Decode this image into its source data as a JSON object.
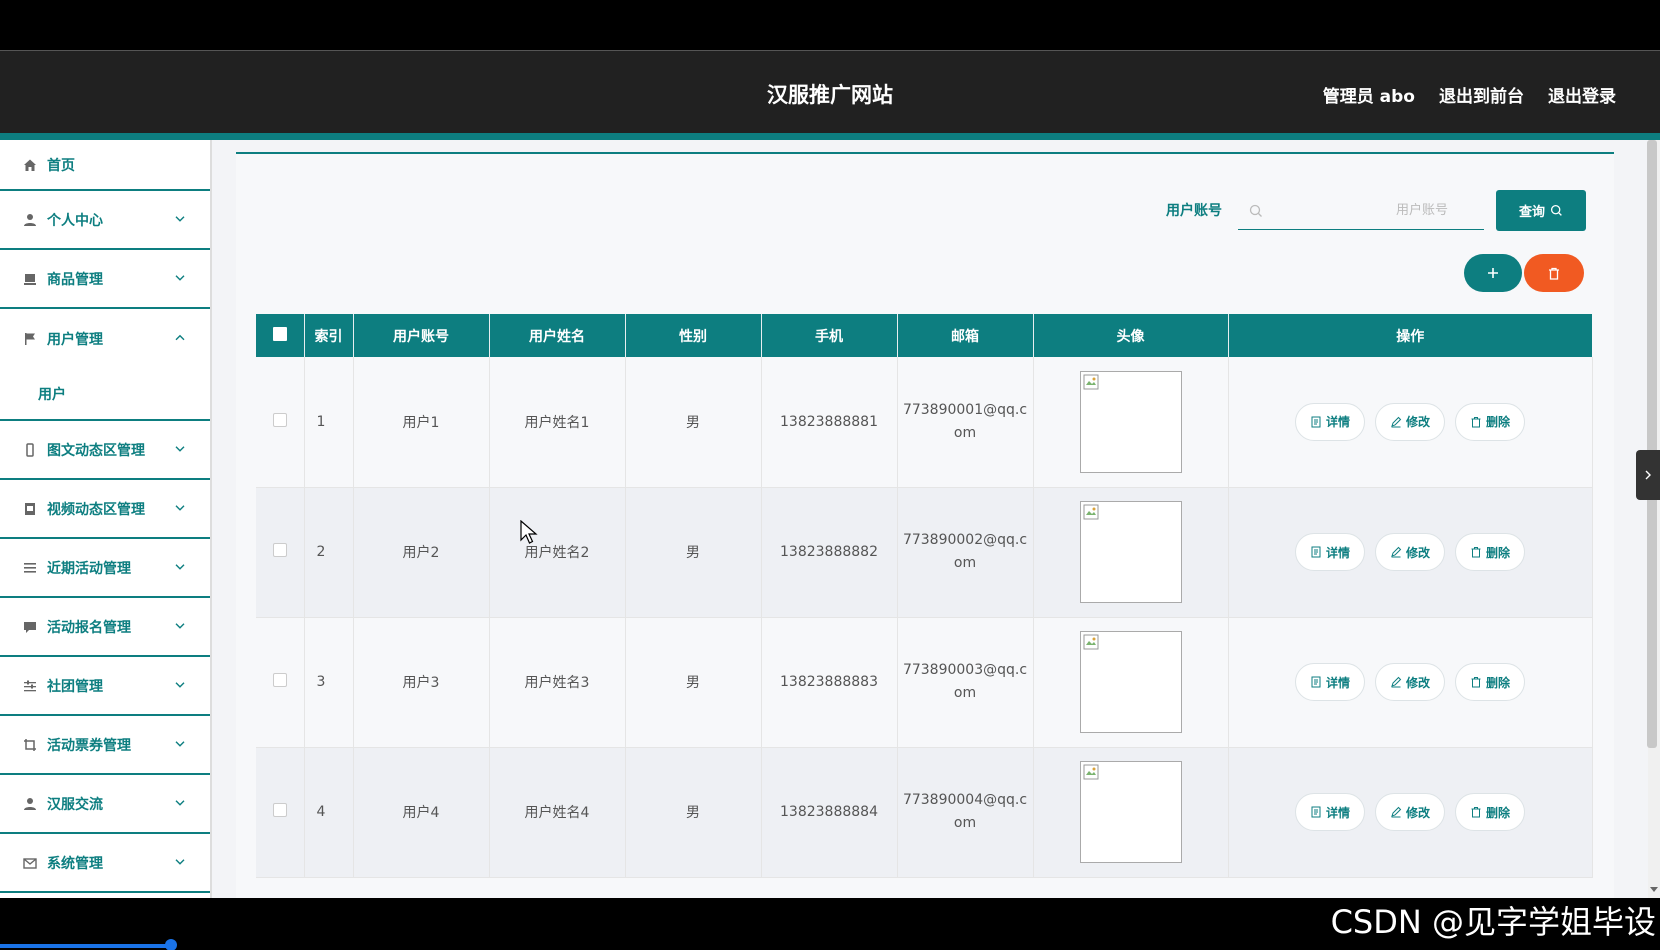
{
  "header": {
    "title": "汉服推广网站",
    "admin_label": "管理员 abo",
    "front_label": "退出到前台",
    "logout_label": "退出登录"
  },
  "sidebar": {
    "items": [
      {
        "label": "首页",
        "icon": "home-icon"
      },
      {
        "label": "个人中心",
        "icon": "user-icon"
      },
      {
        "label": "商品管理",
        "icon": "product-icon"
      },
      {
        "label": "用户管理",
        "icon": "flag-icon",
        "expanded": true
      },
      {
        "label": "图文动态区管理",
        "icon": "phone-icon"
      },
      {
        "label": "视频动态区管理",
        "icon": "video-icon"
      },
      {
        "label": "近期活动管理",
        "icon": "list-icon"
      },
      {
        "label": "活动报名管理",
        "icon": "chat-icon"
      },
      {
        "label": "社团管理",
        "icon": "sliders-icon"
      },
      {
        "label": "活动票券管理",
        "icon": "crop-icon"
      },
      {
        "label": "汉服交流",
        "icon": "user-icon"
      },
      {
        "label": "系统管理",
        "icon": "mail-icon"
      }
    ],
    "sub_item": "用户"
  },
  "search": {
    "label": "用户账号",
    "placeholder": "用户账号",
    "button_label": "查询"
  },
  "table": {
    "headers": [
      "索引",
      "用户账号",
      "用户姓名",
      "性别",
      "手机",
      "邮箱",
      "头像",
      "操作"
    ],
    "rows": [
      {
        "index": "1",
        "account": "用户1",
        "name": "用户姓名1",
        "gender": "男",
        "phone": "13823888881",
        "email": "773890001@qq.com"
      },
      {
        "index": "2",
        "account": "用户2",
        "name": "用户姓名2",
        "gender": "男",
        "phone": "13823888882",
        "email": "773890002@qq.com"
      },
      {
        "index": "3",
        "account": "用户3",
        "name": "用户姓名3",
        "gender": "男",
        "phone": "13823888883",
        "email": "773890003@qq.com"
      },
      {
        "index": "4",
        "account": "用户4",
        "name": "用户姓名4",
        "gender": "男",
        "phone": "13823888884",
        "email": "773890004@qq.com"
      }
    ],
    "actions": {
      "detail": "详情",
      "edit": "修改",
      "delete": "删除"
    }
  },
  "watermark": "CSDN @见字学姐毕设",
  "colors": {
    "accent": "#0d7e80",
    "danger": "#f15a22",
    "header_bg": "#212121"
  }
}
